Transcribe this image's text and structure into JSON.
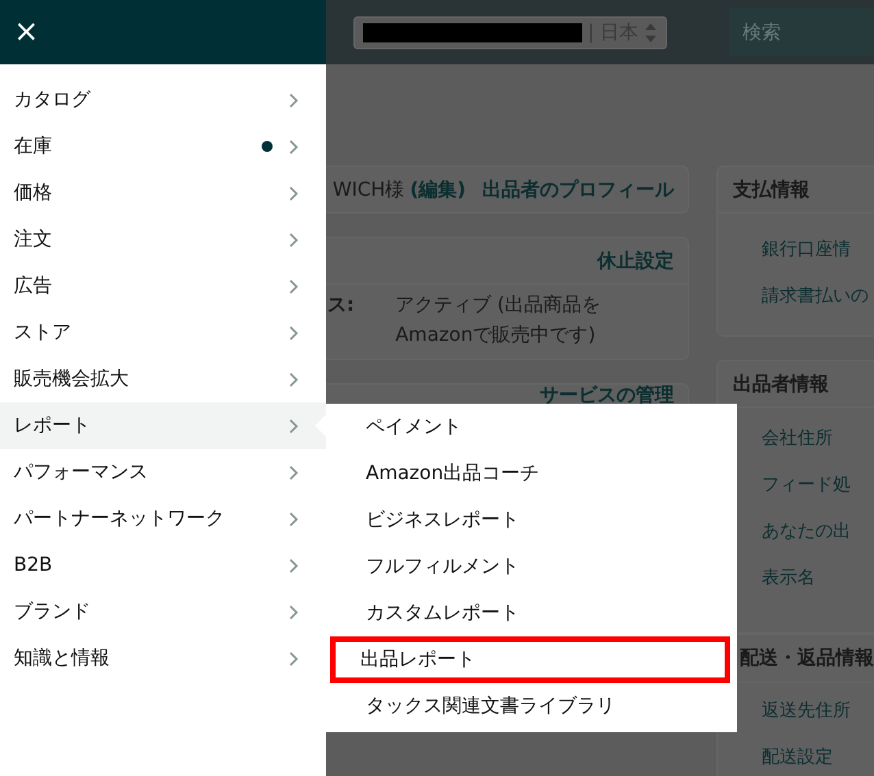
{
  "header": {
    "store_selector": {
      "value": "| 日本"
    },
    "search": {
      "placeholder": "検索"
    }
  },
  "profile_card": {
    "name": "WICH様",
    "edit_link": "(編集)",
    "profile_link": "出品者のプロフィール"
  },
  "status_card": {
    "header_link": "休止設定",
    "label": "ス:",
    "value": "アクティブ (出品商品を\nAmazonで販売中です)"
  },
  "services_card": {
    "header_link": "サービスの管理"
  },
  "payment_card": {
    "title": "支払情報",
    "links": [
      "銀行口座情",
      "請求書払いの"
    ]
  },
  "seller_card": {
    "title": "出品者情報",
    "links": [
      "会社住所",
      "フィード処",
      "あなたの出",
      "表示名"
    ]
  },
  "shipping_card": {
    "title": "配送・返品情報",
    "links": [
      "返送先住所",
      "配送設定"
    ]
  },
  "menu": {
    "close": "×",
    "items": [
      {
        "label": "カタログ",
        "selected": false,
        "badge": false
      },
      {
        "label": "在庫",
        "selected": false,
        "badge": true
      },
      {
        "label": "価格",
        "selected": false,
        "badge": false
      },
      {
        "label": "注文",
        "selected": false,
        "badge": false
      },
      {
        "label": "広告",
        "selected": false,
        "badge": false
      },
      {
        "label": "ストア",
        "selected": false,
        "badge": false
      },
      {
        "label": "販売機会拡大",
        "selected": false,
        "badge": false
      },
      {
        "label": "レポート",
        "selected": true,
        "badge": false
      },
      {
        "label": "パフォーマンス",
        "selected": false,
        "badge": false
      },
      {
        "label": "パートナーネットワーク",
        "selected": false,
        "badge": false
      },
      {
        "label": "B2B",
        "selected": false,
        "badge": false
      },
      {
        "label": "ブランド",
        "selected": false,
        "badge": false
      },
      {
        "label": "知識と情報",
        "selected": false,
        "badge": false
      }
    ]
  },
  "submenu": {
    "items": [
      {
        "label": "ペイメント",
        "highlighted": false
      },
      {
        "label": "Amazon出品コーチ",
        "highlighted": false
      },
      {
        "label": "ビジネスレポート",
        "highlighted": false
      },
      {
        "label": "フルフィルメント",
        "highlighted": false
      },
      {
        "label": "カスタムレポート",
        "highlighted": false
      },
      {
        "label": "出品レポート",
        "highlighted": true
      },
      {
        "label": "タックス関連文書ライブラリ",
        "highlighted": false
      }
    ]
  }
}
